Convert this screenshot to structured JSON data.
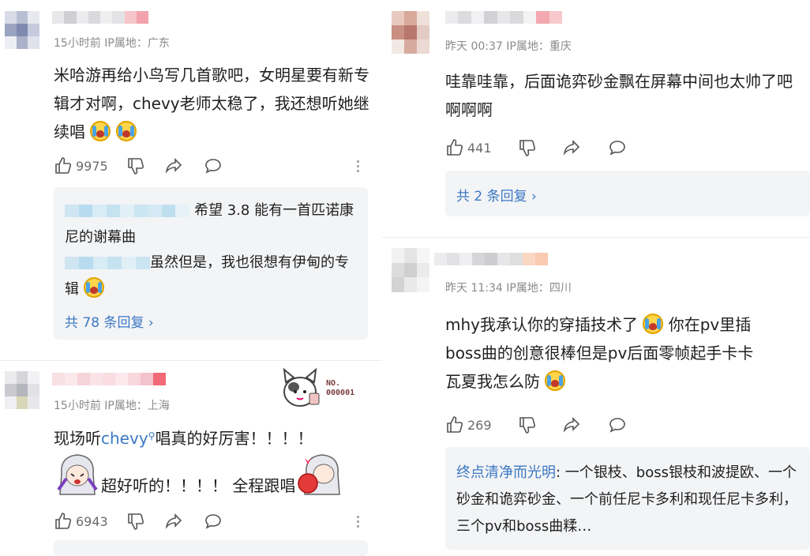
{
  "comments": [
    {
      "timestamp": "15小时前 IP属地：广东",
      "text": "米哈游再给小鸟写几首歌吧，女明星要有新专辑才对啊，chevy老师太稳了，我还想听她继续唱",
      "likes": "9975",
      "replies": [
        {
          "text": "希望 3.8 能有一首匹诺康尼的谢幕曲"
        },
        {
          "text": "虽然但是，我也很想有伊甸的专辑"
        }
      ],
      "more_replies": "共 78 条回复 ›"
    },
    {
      "timestamp": "15小时前 IP属地：上海",
      "text_prefix": "现场听",
      "text_link": "chevy",
      "text_suffix": "唱真的好厉害！！！！",
      "sticker_text": "超好听的！！！！ 全程跟唱",
      "badge": "NO. 000001",
      "likes": "6943"
    },
    {
      "timestamp": "昨天 00:37 IP属地：重庆",
      "text": "哇靠哇靠，后面诡弈砂金飘在屏幕中间也太帅了吧啊啊啊",
      "likes": "441",
      "more_replies": "共 2 条回复 ›"
    },
    {
      "timestamp": "昨天 11:34 IP属地：四川",
      "text_a": "mhy我承认你的穿插技术了",
      "text_b": "你在pv里插",
      "text_c": "boss曲的创意很棒但是pv后面零帧起手卡卡",
      "text_d": "瓦夏我怎么防",
      "likes": "269",
      "reply_author": "终点清净而光明",
      "reply_text": ": 一个银枝、boss银枝和波提欧、一个砂金和诡弈砂金、一个前任尼卡多利和现任尼卡多利，三个pv和boss曲糅…"
    }
  ],
  "icons": [
    "thumb-up-icon",
    "thumb-down-icon",
    "share-icon",
    "comment-icon",
    "more-icon"
  ]
}
